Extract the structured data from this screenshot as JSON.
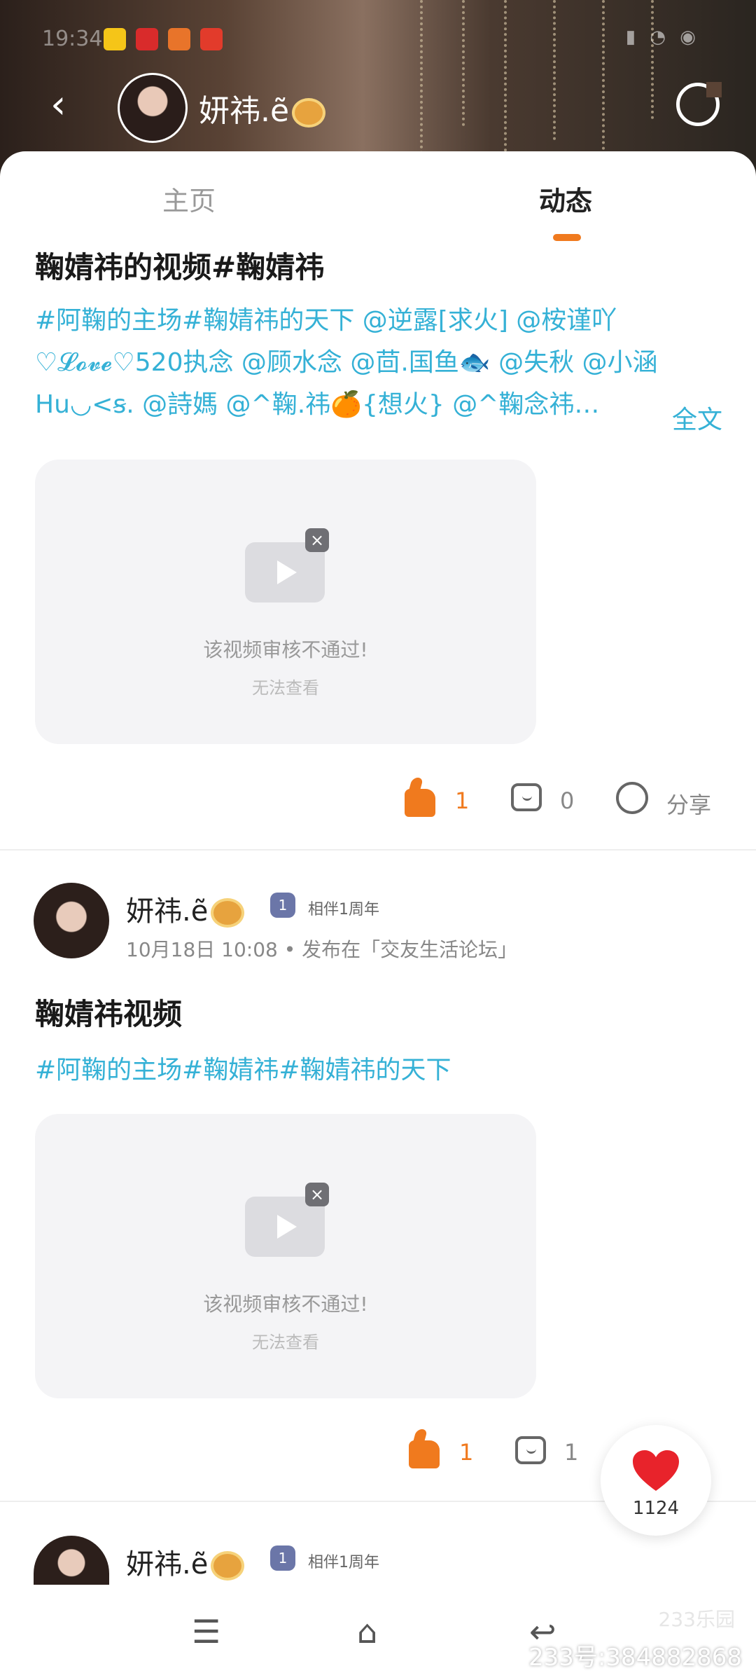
{
  "status_bar": {
    "time": "19:34"
  },
  "header": {
    "username": "妍祎.ẽ"
  },
  "tabs": [
    {
      "label": "主页"
    },
    {
      "label": "动态"
    }
  ],
  "posts": [
    {
      "title": "鞠婧祎的视频#鞠婧祎",
      "tags_text": "#阿鞠的主场#鞠婧祎的天下 @逆露[求火] @桉谨吖♡𝓛𝓸𝓿𝓮♡520执念 @顾水念 @茴.国鱼🐟 @失秋 @小涵Hu◡<ꞩ. @詩媽 @^鞠.祎🍊{想火} @^鞠念祎…",
      "full_text_label": "全文",
      "video_message": "该视频审核不通过!",
      "video_sub": "无法查看",
      "like_count": "1",
      "comment_count": "0",
      "share_label": "分享"
    },
    {
      "author": "妍祎.ẽ",
      "badge_label": "相伴1周年",
      "meta": "10月18日 10:08 • 发布在「交友生活论坛」",
      "title": "鞠婧祎视频",
      "tags_text": "#阿鞠的主场#鞠婧祎#鞠婧祎的天下",
      "video_message": "该视频审核不通过!",
      "video_sub": "无法查看",
      "like_count": "1",
      "comment_count": "1"
    },
    {
      "author": "妍祎.ẽ",
      "badge_label": "相伴1周年"
    }
  ],
  "floating_like": {
    "count": "1124"
  },
  "watermark": {
    "logo": "233乐园",
    "text": "233号:384882868"
  },
  "colors": {
    "accent": "#f07a1e",
    "tag": "#35b1d6"
  },
  "icons": [
    "back-icon",
    "share-icon",
    "thumbs-up-icon",
    "comment-icon",
    "heart-icon",
    "menu-icon",
    "home-icon",
    "back-nav-icon"
  ]
}
